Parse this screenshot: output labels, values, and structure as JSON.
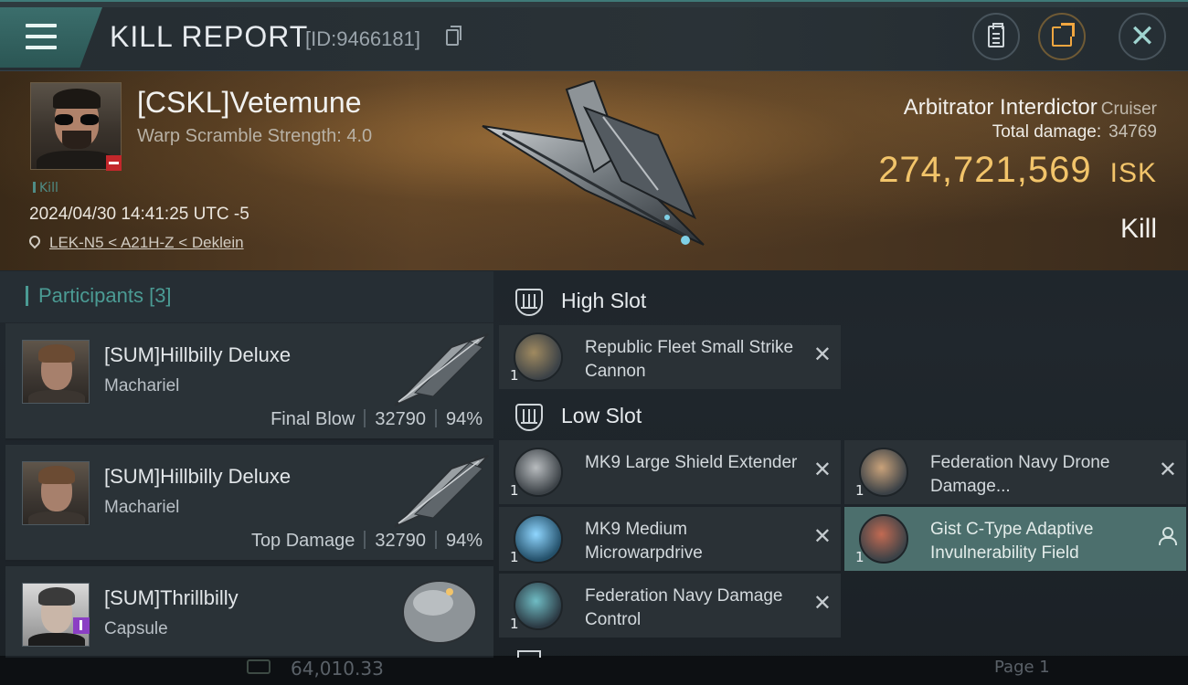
{
  "header": {
    "title": "KILL REPORT",
    "report_id": "[ID:9466181]"
  },
  "victim": {
    "name": "[CSKL]Vetemune",
    "warp_scramble": "Warp Scramble Strength: 4.0",
    "tag": "Kill",
    "datetime": "2024/04/30 14:41:25 UTC -5",
    "location": "LEK-N5 < A21H-Z < Deklein",
    "ship_name": "Arbitrator Interdictor",
    "ship_class": "Cruiser",
    "total_damage_label": "Total damage:",
    "total_damage": "34769",
    "isk_value": "274,721,569",
    "isk_unit": "ISK",
    "result": "Kill"
  },
  "participants": {
    "label": "Participants",
    "count": "[3]",
    "items": [
      {
        "name": "[SUM]Hillbilly Deluxe",
        "ship": "Machariel",
        "role": "Final Blow",
        "damage": "32790",
        "percent": "94%"
      },
      {
        "name": "[SUM]Hillbilly Deluxe",
        "ship": "Machariel",
        "role": "Top Damage",
        "damage": "32790",
        "percent": "94%"
      },
      {
        "name": "[SUM]Thrillbilly",
        "ship": "Capsule"
      }
    ]
  },
  "fitting": {
    "high_slot_label": "High Slot",
    "low_slot_label": "Low Slot",
    "high_slot": [
      {
        "name": "Republic Fleet Small Strike Cannon",
        "qty": "1"
      }
    ],
    "low_slot": [
      {
        "name": "MK9 Large Shield Extender",
        "qty": "1"
      },
      {
        "name": "Federation Navy Drone Damage...",
        "qty": "1"
      },
      {
        "name": "MK9 Medium Microwarpdrive",
        "qty": "1"
      },
      {
        "name": "Gist C-Type Adaptive Invulnerability Field",
        "qty": "1"
      },
      {
        "name": "Federation Navy Damage Control",
        "qty": "1"
      }
    ]
  },
  "background": {
    "bottom_value": "64,010.33",
    "page_label": "Page 1"
  },
  "colors": {
    "accent_teal": "#4b9b94",
    "isk_gold": "#f2c46a",
    "highlight_row": "#4c6f6d",
    "status_red": "#c3272b",
    "capsule_badge": "#8b3fc4"
  },
  "icons": [
    "menu-icon",
    "copy-icon",
    "clipboard-icon",
    "share-icon",
    "close-icon",
    "location-pin-icon",
    "slot-icon",
    "remove-icon",
    "person-icon"
  ]
}
